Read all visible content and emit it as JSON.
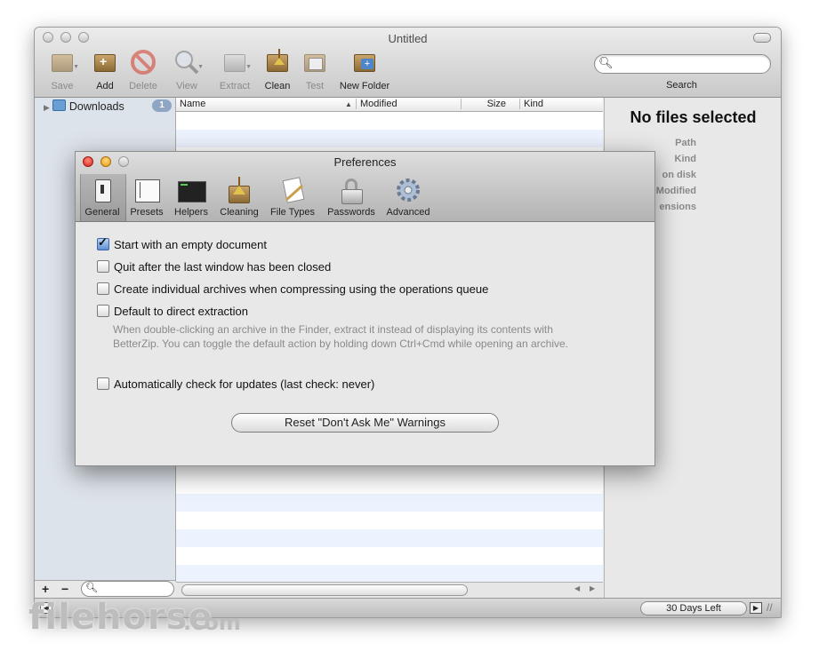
{
  "window": {
    "title": "Untitled"
  },
  "toolbar": [
    {
      "label": "Save",
      "icon": "archive-save-icon",
      "enabled": false
    },
    {
      "label": "Add",
      "icon": "archive-add-icon",
      "enabled": true
    },
    {
      "label": "Delete",
      "icon": "delete-icon",
      "enabled": false
    },
    {
      "label": "View",
      "icon": "view-magnifier-icon",
      "enabled": false
    },
    {
      "label": "Extract",
      "icon": "extract-icon",
      "enabled": false
    },
    {
      "label": "Clean",
      "icon": "clean-broom-icon",
      "enabled": true
    },
    {
      "label": "Test",
      "icon": "test-icon",
      "enabled": false
    },
    {
      "label": "New Folder",
      "icon": "new-folder-icon",
      "enabled": true
    }
  ],
  "search": {
    "label": "Search",
    "placeholder": ""
  },
  "sidebar": {
    "items": [
      {
        "label": "Downloads",
        "badge": "1"
      }
    ]
  },
  "columns": [
    "Name",
    "Modified",
    "Size",
    "Kind"
  ],
  "info": {
    "title": "No files selected",
    "labels": [
      "Path",
      "Kind",
      "on disk",
      "Modified",
      "ensions"
    ]
  },
  "status": {
    "trial": "30 Days Left"
  },
  "prefs": {
    "title": "Preferences",
    "tabs": [
      {
        "label": "General",
        "icon": "switch-icon",
        "selected": true
      },
      {
        "label": "Presets",
        "icon": "presets-icon"
      },
      {
        "label": "Helpers",
        "icon": "terminal-icon"
      },
      {
        "label": "Cleaning",
        "icon": "broom-icon"
      },
      {
        "label": "File Types",
        "icon": "file-types-icon"
      },
      {
        "label": "Passwords",
        "icon": "padlock-icon"
      },
      {
        "label": "Advanced",
        "icon": "gear-icon"
      }
    ],
    "options": [
      {
        "label": "Start with an empty document",
        "checked": true
      },
      {
        "label": "Quit after the last window has been closed",
        "checked": false
      },
      {
        "label": "Create individual archives when compressing using the operations queue",
        "checked": false
      },
      {
        "label": "Default to direct extraction",
        "checked": false
      },
      {
        "label": "Automatically check for updates (last check: never)",
        "checked": false
      }
    ],
    "hint_line1": "When double-clicking an archive in the Finder, extract it instead of displaying its contents with",
    "hint_line2": "BetterZip. You can toggle the default action by holding down Ctrl+Cmd while opening an archive.",
    "reset_label": "Reset \"Don't Ask Me\" Warnings"
  },
  "watermark": {
    "text": "filehorse",
    "suffix": ".com"
  }
}
